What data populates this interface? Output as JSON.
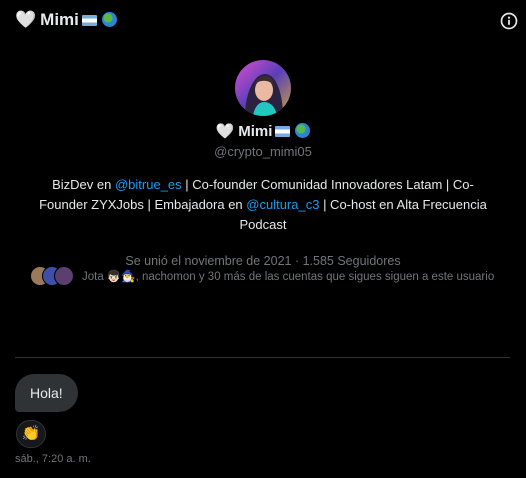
{
  "header": {
    "title": "Mimi",
    "heart_emoji": "🤍",
    "info_icon": "info-circle-icon"
  },
  "profile": {
    "display_name": "Mimi",
    "handle": "@crypto_mimi05",
    "bio": {
      "p1": "BizDev en ",
      "link1": "@bitrue_es",
      "p2": " | Co-founder Comunidad Innovadores Latam | Co-Founder ZYXJobs | Embajadora en ",
      "link2": "@cultura_c3",
      "p3": " | Co-host en Alta Frecuencia Podcast"
    },
    "joined": "Se unió el noviembre de 2021",
    "separator": " · ",
    "followers": "1.585 Seguidores",
    "followed_by": "Jota 👦🏻🧙‍♂️, nachomon y 30 más de las cuentas que sigues siguen a este usuario"
  },
  "messages": [
    {
      "text": "Hola!",
      "reaction": "👏",
      "timestamp": "sáb., 7:20 a. m."
    }
  ],
  "colors": {
    "background": "#000000",
    "text": "#e7e9ea",
    "muted": "#71767b",
    "link": "#1d9bf0",
    "bubble": "#2f3336"
  }
}
